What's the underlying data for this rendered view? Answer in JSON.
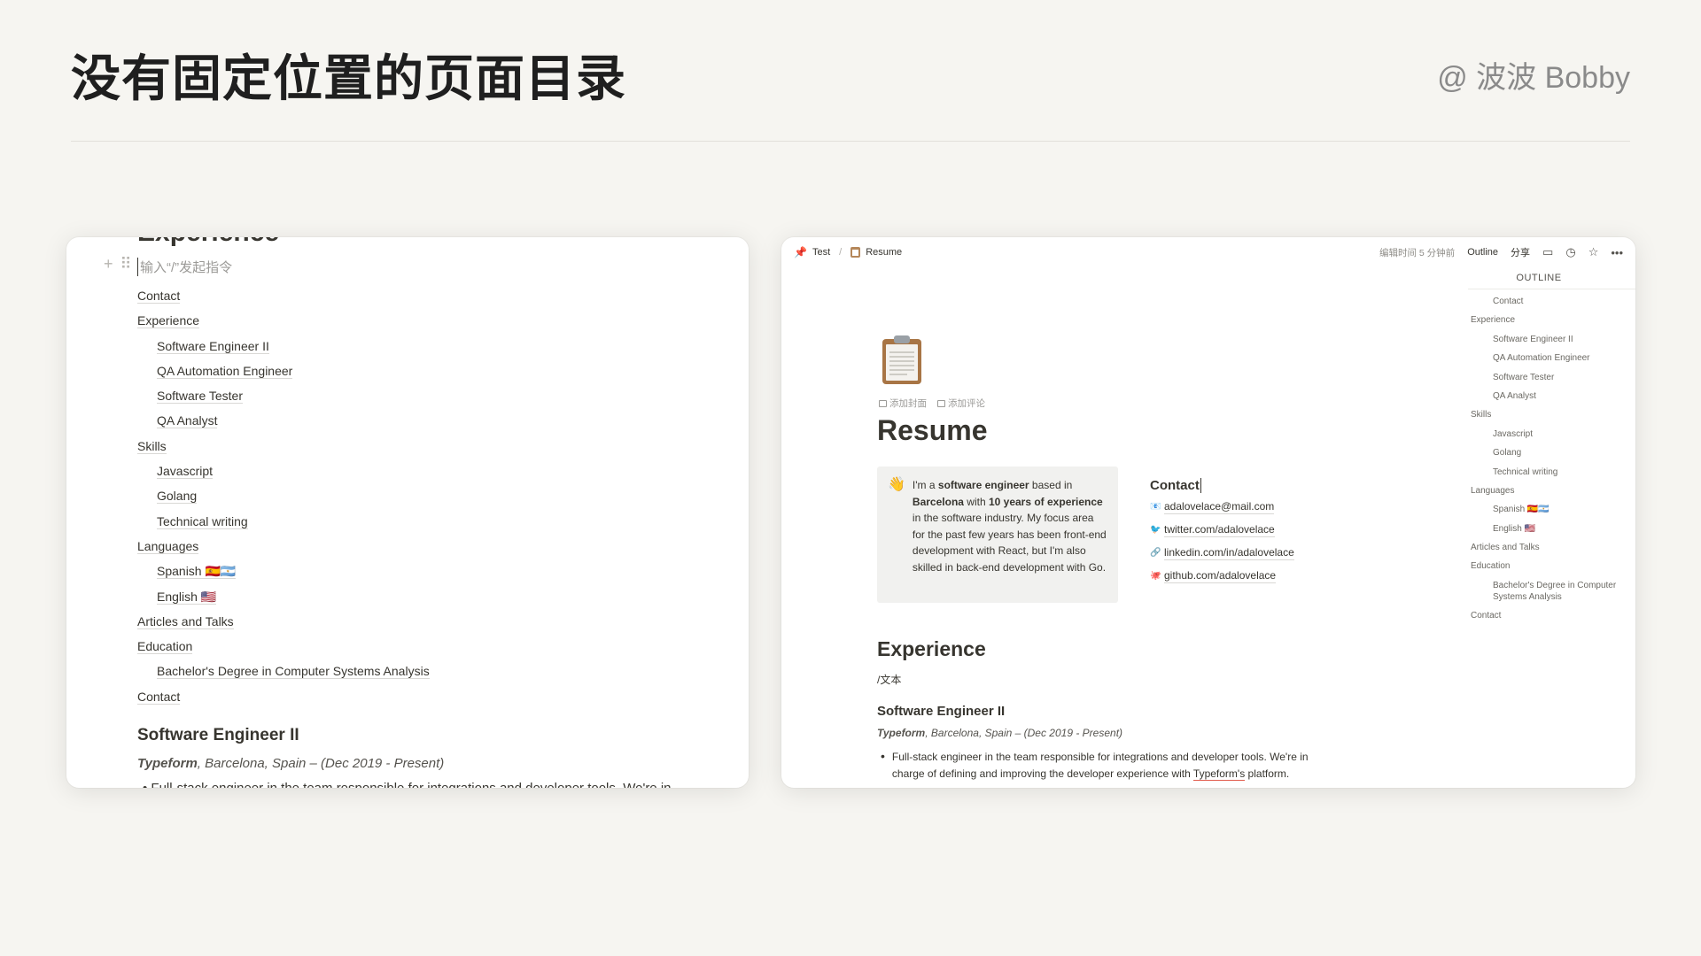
{
  "slide": {
    "title": "没有固定位置的页面目录",
    "author": "@ 波波 Bobby"
  },
  "left": {
    "cut_heading": "Experience",
    "placeholder": "输入“/”发起指令",
    "toc": [
      {
        "label": "Contact",
        "level": 1
      },
      {
        "label": "Experience",
        "level": 1
      },
      {
        "label": "Software Engineer II",
        "level": 2
      },
      {
        "label": "QA Automation Engineer",
        "level": 2
      },
      {
        "label": "Software Tester",
        "level": 2
      },
      {
        "label": "QA Analyst",
        "level": 2
      },
      {
        "label": "Skills",
        "level": 1
      },
      {
        "label": "Javascript",
        "level": 2
      },
      {
        "label": "Golang",
        "level": 2
      },
      {
        "label": "Technical writing",
        "level": 2
      },
      {
        "label": "Languages",
        "level": 1
      },
      {
        "label": "Spanish 🇪🇸🇦🇷",
        "level": 2
      },
      {
        "label": "English 🇺🇸",
        "level": 2
      },
      {
        "label": "Articles and Talks",
        "level": 1
      },
      {
        "label": "Education",
        "level": 1
      },
      {
        "label": "Bachelor's Degree in Computer Systems Analysis",
        "level": 2
      },
      {
        "label": "Contact",
        "level": 1
      }
    ],
    "section_title": "Software Engineer II",
    "section_company": "Typeform",
    "section_detail": ", Barcelona, Spain – (Dec 2019 - Present)",
    "cut_bullet": "Full-stack engineer in the team responsible for integrations and developer tools. We're in"
  },
  "right": {
    "breadcrumb": [
      "Test",
      "Resume"
    ],
    "edited": "编辑时间 5 分钟前",
    "outline_btn": "Outline",
    "share_btn": "分享",
    "outline_title": "OUTLINE",
    "outline": [
      {
        "label": "Contact",
        "level": 2
      },
      {
        "label": "Experience",
        "level": 1
      },
      {
        "label": "Software Engineer II",
        "level": 2
      },
      {
        "label": "QA Automation Engineer",
        "level": 2
      },
      {
        "label": "Software Tester",
        "level": 2
      },
      {
        "label": "QA Analyst",
        "level": 2
      },
      {
        "label": "Skills",
        "level": 1
      },
      {
        "label": "Javascript",
        "level": 2
      },
      {
        "label": "Golang",
        "level": 2
      },
      {
        "label": "Technical writing",
        "level": 2
      },
      {
        "label": "Languages",
        "level": 1
      },
      {
        "label": "Spanish 🇪🇸🇦🇷",
        "level": 2
      },
      {
        "label": "English 🇺🇸",
        "level": 2
      },
      {
        "label": "Articles and Talks",
        "level": 1
      },
      {
        "label": "Education",
        "level": 1
      },
      {
        "label": "Bachelor's Degree in Computer Systems Analysis",
        "level": 2
      },
      {
        "label": "Contact",
        "level": 1
      }
    ],
    "add_cover": "添加封面",
    "add_comment": "添加评论",
    "page_title": "Resume",
    "callout_emoji": "👋",
    "callout_parts": [
      {
        "t": "I'm a ",
        "b": false
      },
      {
        "t": "software engineer",
        "b": true
      },
      {
        "t": " based in ",
        "b": false
      },
      {
        "t": "Barcelona",
        "b": true
      },
      {
        "t": " with ",
        "b": false
      },
      {
        "t": "10 years of experience",
        "b": true
      },
      {
        "t": " in the software industry. My focus area for the past few years has been front-end development with React, but I'm also skilled in back-end development with Go.",
        "b": false
      }
    ],
    "contact_title": "Contact",
    "contacts": [
      {
        "icon": "📧",
        "text": "adalovelace@mail.com"
      },
      {
        "icon": "🐦",
        "text": "twitter.com/adalovelace"
      },
      {
        "icon": "🔗",
        "text": "linkedin.com/in/adalovelace"
      },
      {
        "icon": "🐙",
        "text": "github.com/adalovelace"
      }
    ],
    "exp_heading": "Experience",
    "slash_text": "/文本",
    "job_title": "Software Engineer II",
    "job_company": "Typeform",
    "job_detail": ", Barcelona, Spain – (Dec 2019 - Present)",
    "bullet_before": "Full-stack engineer in the team responsible for integrations and developer tools. We're in charge of defining and improving the developer experience with ",
    "bullet_link": "Typeform's",
    "bullet_after": " platform."
  }
}
